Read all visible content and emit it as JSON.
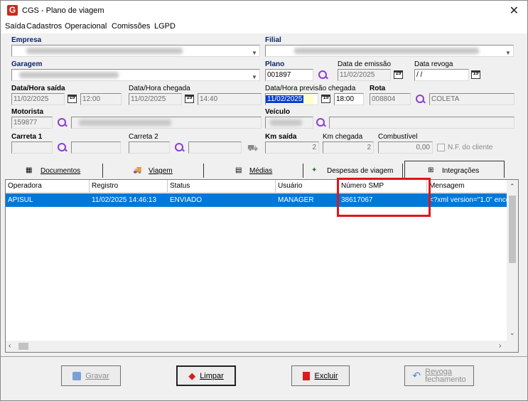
{
  "window": {
    "title": "CGS - Plano de viagem",
    "logo_letter": "G"
  },
  "menu": [
    "Saída",
    "Cadastros",
    "Operacional",
    "Comissões",
    "LGPD"
  ],
  "form": {
    "empresa_label": "Empresa",
    "filial_label": "Filial",
    "garagem_label": "Garagem",
    "plano_label": "Plano",
    "plano_value": "001897",
    "data_emissao_label": "Data de emissão",
    "data_emissao_value": "11/02/2025",
    "data_revoga_label": "Data revoga",
    "data_revoga_value": " / /",
    "saida_label": "Data/Hora saída",
    "saida_date": "11/02/2025",
    "saida_time": "12:00",
    "chegada_label": "Data/Hora chegada",
    "chegada_date": "11/02/2025",
    "chegada_time": "14:40",
    "prev_label": "Data/Hora previsão chegada",
    "prev_date": "11/02/2025",
    "prev_time": "18:00",
    "rota_label": "Rota",
    "rota_code": "008804",
    "rota_name": "COLETA",
    "motorista_label": "Motorista",
    "motorista_code": "159877",
    "veiculo_label": "Veículo",
    "carreta1_label": "Carreta 1",
    "carreta2_label": "Carreta 2",
    "km_saida_label": "Km saída",
    "km_saida_value": "2",
    "km_chegada_label": "Km chegada",
    "km_chegada_value": "2",
    "combustivel_label": "Combustível",
    "combustivel_value": "0,00",
    "nf_label": "N.F. do cliente"
  },
  "tabs": [
    "Documentos",
    "Viagem",
    "Médias",
    "Despesas de viagem",
    "Integrações"
  ],
  "grid": {
    "columns": [
      "Operadora",
      "Registro",
      "Status",
      "Usuário",
      "Número SMP",
      "Mensagem"
    ],
    "rows": [
      [
        "APISUL",
        "11/02/2025 14:46:13",
        "ENVIADO",
        "MANAGER",
        "38617067",
        "<?xml version=\"1.0\" enco"
      ]
    ]
  },
  "buttons": {
    "gravar": "Gravar",
    "limpar": "Limpar",
    "excluir": "Excluir",
    "revoga_line1": "Revoga",
    "revoga_line2": "fechamento"
  },
  "colors": {
    "selection": "#0078d7",
    "highlight_box": "#e0141a",
    "label_blue": "#0a246a"
  }
}
